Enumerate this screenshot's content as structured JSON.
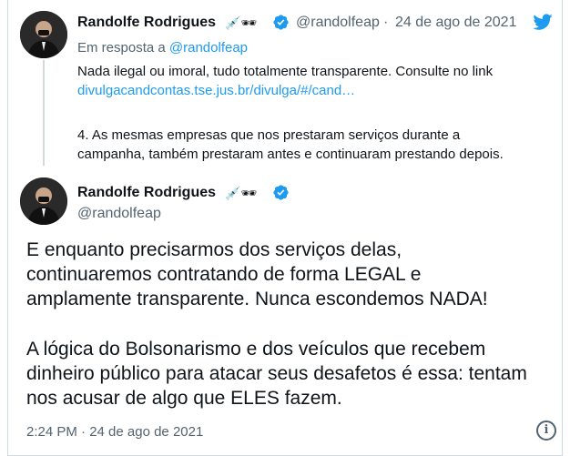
{
  "tweet1": {
    "name": "Randolfe Rodrigues",
    "emoji": "💉🕶",
    "handle": "@randolfeap",
    "separator": "·",
    "date": "24 de ago de 2021",
    "reply_prefix": "Em resposta a",
    "reply_to": "@randolfeap",
    "line1": "Nada ilegal ou imoral, tudo totalmente transparente. Consulte no link",
    "link": "divulgacandcontas.tse.jus.br/divulga/#/cand…",
    "para2_line1": "4. As mesmas empresas que nos prestaram serviços durante a",
    "para2_line2": "campanha, também prestaram antes e continuaram prestando depois."
  },
  "tweet2": {
    "name": "Randolfe Rodrigues",
    "emoji": "💉🕶",
    "handle": "@randolfeap",
    "p1_l1": "E enquanto precisarmos dos serviços delas,",
    "p1_l2": "continuaremos contratando de forma LEGAL e",
    "p1_l3": "amplamente transparente. Nunca escondemos NADA!",
    "p2_l1": "A lógica do Bolsonarismo e dos veículos que recebem",
    "p2_l2": "dinheiro público para atacar seus desafetos é essa: tentam",
    "p2_l3": "nos acusar de algo que ELES fazem.",
    "timestamp": "2:24 PM · 24 de ago de 2021"
  },
  "colors": {
    "accent": "#1d9bf0",
    "secondary_text": "#536471",
    "primary_text": "#0f1419",
    "border": "#cfd9de"
  },
  "icons": [
    "avatar",
    "verified-badge-icon",
    "twitter-bird-icon",
    "info-icon"
  ]
}
